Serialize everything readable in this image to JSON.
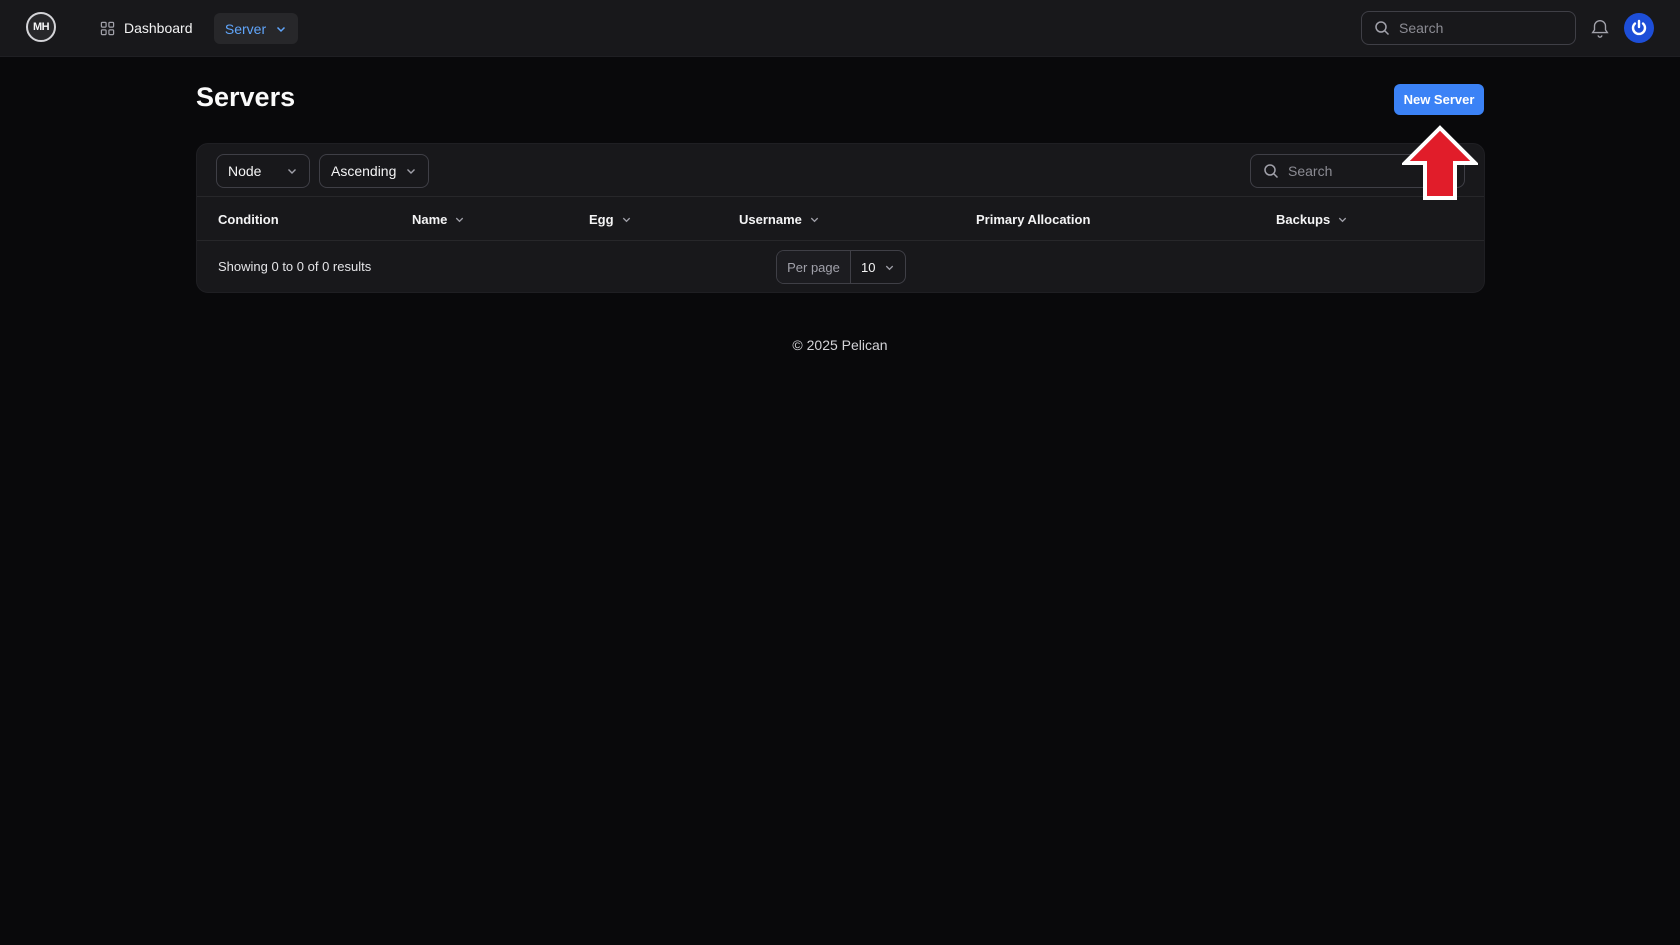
{
  "topbar": {
    "logo_text": "MH",
    "nav_dashboard": "Dashboard",
    "nav_server": "Server",
    "search_placeholder": "Search"
  },
  "page": {
    "title": "Servers",
    "new_server_label": "New Server"
  },
  "table": {
    "group_select": "Node",
    "direction_select": "Ascending",
    "search_placeholder": "Search",
    "columns": [
      {
        "label": "Condition",
        "sortable": false
      },
      {
        "label": "Name",
        "sortable": true
      },
      {
        "label": "Egg",
        "sortable": true
      },
      {
        "label": "Username",
        "sortable": true
      },
      {
        "label": "Primary Allocation",
        "sortable": false
      },
      {
        "label": "Backups",
        "sortable": true
      }
    ],
    "results_text": "Showing 0 to 0 of 0 results",
    "per_page_label": "Per page",
    "per_page_value": "10"
  },
  "footer": {
    "copyright": "© 2025 Pelican"
  },
  "colors": {
    "accent": "#3b82f6",
    "annotation_arrow": "#e11d2a"
  },
  "icons": [
    "logo-icon",
    "grid-icon",
    "chevron-down-icon",
    "search-icon",
    "bell-icon",
    "power-icon",
    "red-arrow-annotation"
  ]
}
